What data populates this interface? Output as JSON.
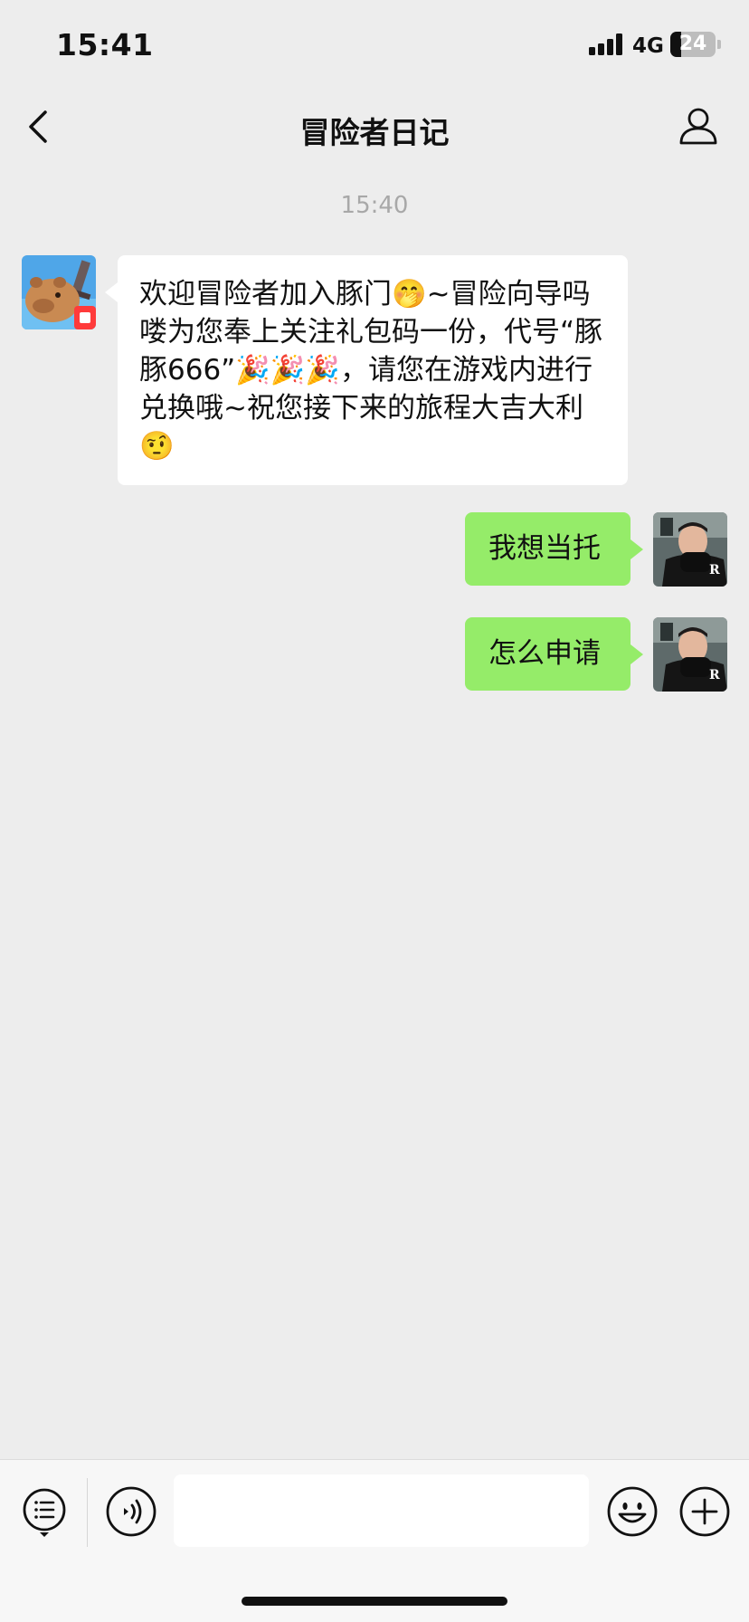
{
  "status_bar": {
    "time": "15:41",
    "network": "4G",
    "battery_level": "24"
  },
  "nav": {
    "title": "冒险者日记"
  },
  "chat": {
    "timestamp": "15:40",
    "messages": [
      {
        "side": "left",
        "text": "欢迎冒险者加入豚门🤭~冒险向导吗喽为您奉上关注礼包码一份，代号“豚豚666”🎉🎉🎉，请您在游戏内进行兑换哦~祝您接下来的旅程大吉大利🤨"
      },
      {
        "side": "right",
        "text": "我想当托"
      },
      {
        "side": "right",
        "text": "怎么申请"
      }
    ]
  },
  "colors": {
    "background": "#ededed",
    "sent_bubble": "#95ec69",
    "received_bubble": "#ffffff",
    "timestamp_text": "#a8a8a8"
  },
  "icons": {
    "back": "chevron-left-icon",
    "profile": "person-icon",
    "menu": "list-menu-icon",
    "voice": "voice-icon",
    "emoji": "smiley-icon",
    "more": "plus-icon"
  }
}
